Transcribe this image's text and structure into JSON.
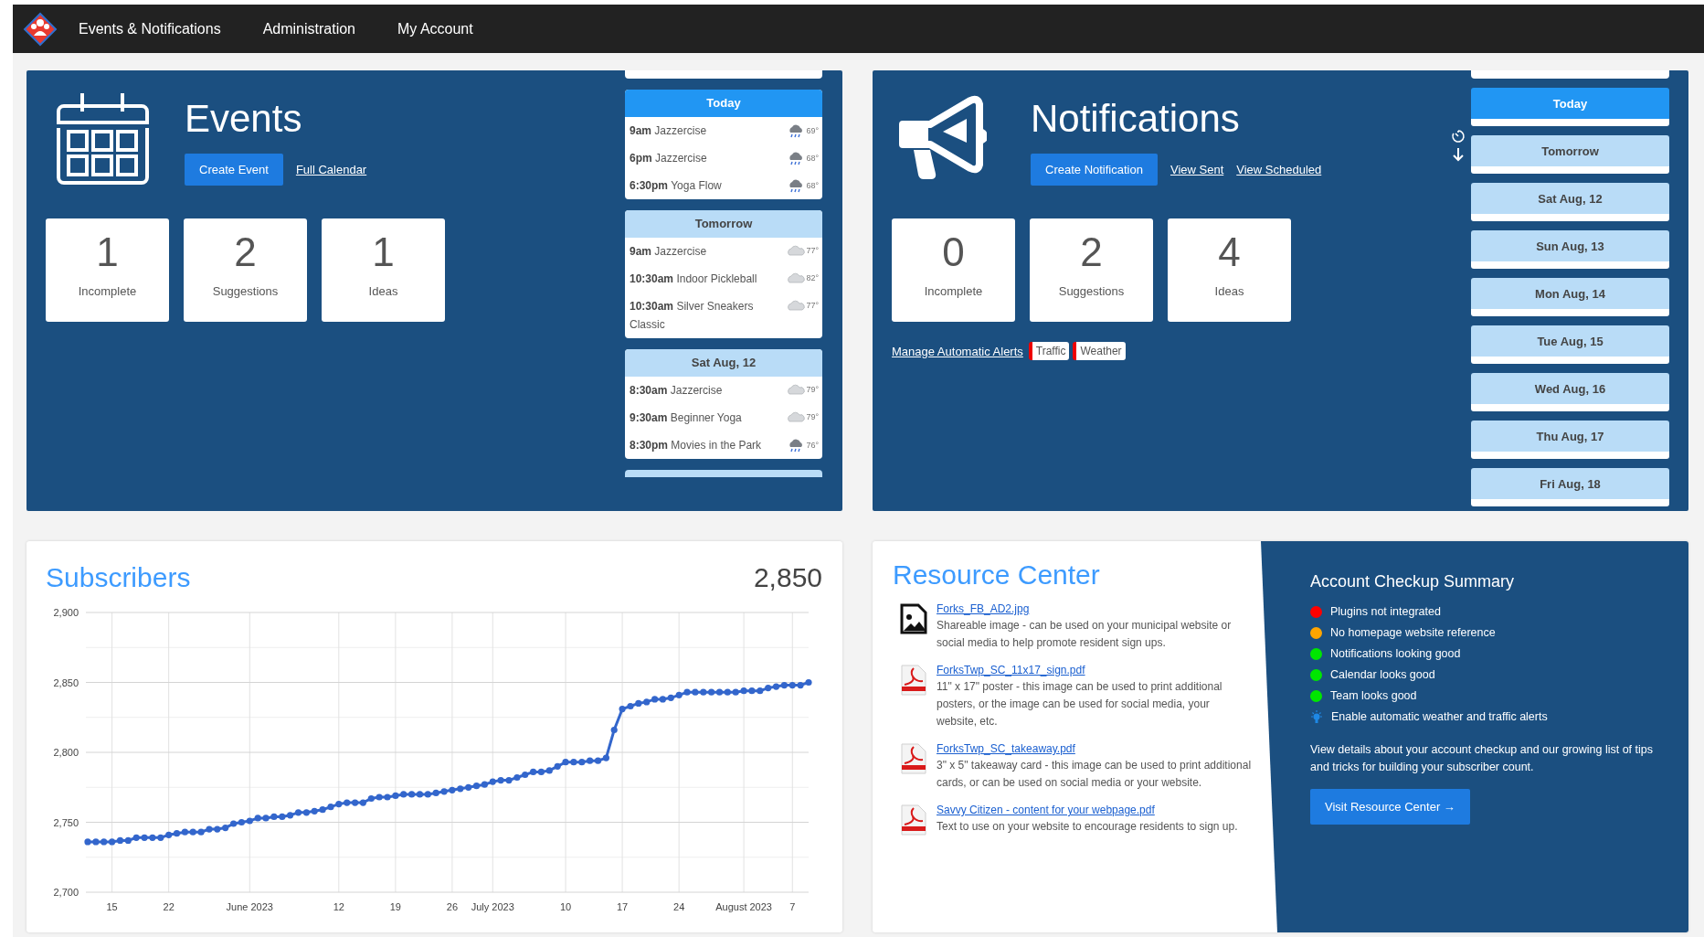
{
  "nav": {
    "items": [
      {
        "label": "Events & Notifications"
      },
      {
        "label": "Administration"
      },
      {
        "label": "My Account"
      }
    ]
  },
  "events": {
    "title": "Events",
    "create_button": "Create Event",
    "link": "Full Calendar",
    "stats": [
      {
        "value": "1",
        "label": "Incomplete"
      },
      {
        "value": "2",
        "label": "Suggestions"
      },
      {
        "value": "1",
        "label": "Ideas"
      }
    ],
    "days": [
      {
        "label": "Today",
        "selected": true,
        "items": [
          {
            "time": "9am",
            "title": "Jazzercise",
            "kind": "rain",
            "temp": "69°"
          },
          {
            "time": "6pm",
            "title": "Jazzercise",
            "kind": "rain",
            "temp": "68°"
          },
          {
            "time": "6:30pm",
            "title": "Yoga Flow",
            "kind": "rain",
            "temp": "68°"
          }
        ]
      },
      {
        "label": "Tomorrow",
        "selected": false,
        "items": [
          {
            "time": "9am",
            "title": "Jazzercise",
            "kind": "cloudy",
            "temp": "77°"
          },
          {
            "time": "10:30am",
            "title": "Indoor Pickleball",
            "kind": "cloudy",
            "temp": "82°"
          },
          {
            "time": "10:30am",
            "title": "Silver Sneakers Classic",
            "kind": "cloudy",
            "temp": "77°"
          }
        ]
      },
      {
        "label": "Sat Aug, 12",
        "selected": false,
        "items": [
          {
            "time": "8:30am",
            "title": "Jazzercise",
            "kind": "cloudy",
            "temp": "79°"
          },
          {
            "time": "9:30am",
            "title": "Beginner Yoga",
            "kind": "cloudy",
            "temp": "79°"
          },
          {
            "time": "8:30pm",
            "title": "Movies in the Park",
            "kind": "rain",
            "temp": "76°"
          }
        ]
      }
    ]
  },
  "notifications": {
    "title": "Notifications",
    "create_button": "Create Notification",
    "links": [
      {
        "label": "View Sent"
      },
      {
        "label": "View Scheduled"
      }
    ],
    "stats": [
      {
        "value": "0",
        "label": "Incomplete"
      },
      {
        "value": "2",
        "label": "Suggestions"
      },
      {
        "value": "4",
        "label": "Ideas"
      }
    ],
    "alerts_link": "Manage Automatic Alerts",
    "alerts": [
      {
        "label": "Traffic",
        "enabled": false
      },
      {
        "label": "Weather",
        "enabled": false
      }
    ],
    "days": [
      {
        "label": "Today",
        "selected": true
      },
      {
        "label": "Tomorrow",
        "selected": false
      },
      {
        "label": "Sat Aug, 12",
        "selected": false
      },
      {
        "label": "Sun Aug, 13",
        "selected": false
      },
      {
        "label": "Mon Aug, 14",
        "selected": false
      },
      {
        "label": "Tue Aug, 15",
        "selected": false
      },
      {
        "label": "Wed Aug, 16",
        "selected": false
      },
      {
        "label": "Thu Aug, 17",
        "selected": false
      },
      {
        "label": "Fri Aug, 18",
        "selected": false
      }
    ]
  },
  "subscribers": {
    "title": "Subscribers",
    "total": "2,850",
    "chart_data": {
      "type": "line",
      "categories": [
        null,
        null,
        null,
        "15",
        null,
        null,
        null,
        null,
        null,
        null,
        "22",
        null,
        null,
        null,
        null,
        null,
        null,
        null,
        null,
        null,
        "June 2023",
        null,
        null,
        null,
        null,
        null,
        null,
        null,
        null,
        null,
        null,
        "12",
        null,
        null,
        null,
        null,
        null,
        null,
        "19",
        null,
        null,
        null,
        null,
        null,
        null,
        "26",
        null,
        null,
        null,
        null,
        "July 2023",
        null,
        null,
        null,
        null,
        null,
        null,
        null,
        null,
        "10",
        null,
        null,
        null,
        null,
        null,
        null,
        "17",
        null,
        null,
        null,
        null,
        null,
        null,
        "24",
        null,
        null,
        null,
        null,
        null,
        null,
        null,
        "August 2023",
        null,
        null,
        null,
        null,
        null,
        "7",
        null,
        null
      ],
      "grid": true,
      "series": [
        {
          "color": "#3366cc",
          "marker": "circle",
          "values": [
            2736,
            2736,
            2736,
            2736,
            2737,
            2737,
            2739,
            2739,
            2739,
            2739,
            2741,
            2742,
            2743,
            2743,
            2743,
            2745,
            2745,
            2746,
            2749,
            2750,
            2751,
            2753,
            2753,
            2754,
            2754,
            2755,
            2757,
            2757,
            2758,
            2759,
            2761,
            2763,
            2764,
            2764,
            2764,
            2767,
            2768,
            2768,
            2769,
            2770,
            2770,
            2770,
            2770,
            2771,
            2772,
            2773,
            2774,
            2775,
            2776,
            2777,
            2779,
            2780,
            2780,
            2782,
            2784,
            2786,
            2786,
            2787,
            2790,
            2793,
            2793,
            2793,
            2794,
            2794,
            2796,
            2816,
            2831,
            2833,
            2835,
            2836,
            2838,
            2838,
            2839,
            2841,
            2843,
            2843,
            2843,
            2843,
            2843,
            2843,
            2843,
            2844,
            2844,
            2844,
            2846,
            2847,
            2848,
            2848,
            2848,
            2850
          ]
        }
      ],
      "ylim": [
        2700,
        2900
      ],
      "yticks": [
        {
          "value": 2700,
          "label": "2,700"
        },
        {
          "value": 2750,
          "label": "2,750"
        },
        {
          "value": 2800,
          "label": "2,800"
        },
        {
          "value": 2850,
          "label": "2,850"
        },
        {
          "value": 2900,
          "label": "2,900"
        }
      ]
    }
  },
  "resources": {
    "title": "Resource Center",
    "items": [
      {
        "kind": "image",
        "file": "Forks_FB_AD2.jpg",
        "description": "Shareable image - can be used on your municipal website or social media to help promote resident sign ups."
      },
      {
        "kind": "pdf",
        "file": "ForksTwp_SC_11x17_sign.pdf",
        "description": "11\" x 17\" poster - this image can be used to print additional posters, or the image can be used for social media, your website, etc."
      },
      {
        "kind": "pdf",
        "file": "ForksTwp_SC_takeaway.pdf",
        "description": "3\" x 5\" takeaway card - this image can be used to print additional cards, or can be used on social media or your website."
      },
      {
        "kind": "pdf",
        "file": "Savvy Citizen - content for your webpage.pdf",
        "description": "Text to use on your website to encourage residents to sign up."
      }
    ]
  },
  "checkup": {
    "title": "Account Checkup Summary",
    "items": [
      {
        "kind": "status",
        "label": "Plugins not integrated",
        "color": "#ff0000"
      },
      {
        "kind": "status",
        "label": "No homepage website reference",
        "color": "#ffa500"
      },
      {
        "kind": "status",
        "label": "Notifications looking good",
        "color": "#00e600"
      },
      {
        "kind": "status",
        "label": "Calendar looks good",
        "color": "#00e600"
      },
      {
        "kind": "status",
        "label": "Team looks good",
        "color": "#00e600"
      },
      {
        "kind": "tip",
        "label": "Enable automatic weather and traffic alerts"
      }
    ],
    "text": "View details about your account checkup and our growing list of tips and tricks for building your subscriber count.",
    "button": "Visit Resource Center →"
  }
}
